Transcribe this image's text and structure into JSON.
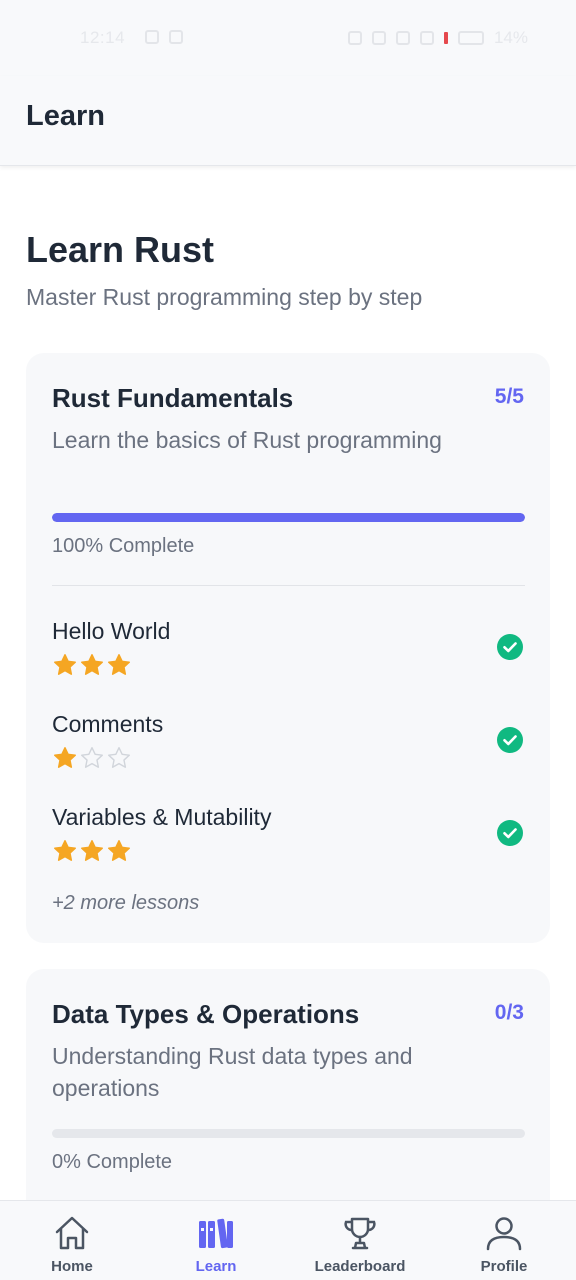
{
  "status_bar": {
    "time": "12:14",
    "battery": "14%"
  },
  "header": {
    "title": "Learn"
  },
  "page": {
    "title": "Learn Rust",
    "subtitle": "Master Rust programming step by step"
  },
  "modules": [
    {
      "title": "Rust Fundamentals",
      "count": "5/5",
      "description": "Learn the basics of Rust programming",
      "progress": 1.0,
      "progress_label": "100% Complete",
      "lessons": [
        {
          "title": "Hello World",
          "stars": 3,
          "icon": "check-circle-icon"
        },
        {
          "title": "Comments",
          "stars": 1,
          "icon": "check-circle-icon"
        },
        {
          "title": "Variables & Mutability",
          "stars": 3,
          "icon": "check-circle-icon"
        }
      ],
      "more_lessons": "+2 more lessons"
    },
    {
      "title": "Data Types & Operations",
      "count": "0/3",
      "description": "Understanding Rust data types and operations",
      "progress": 0.0,
      "progress_label": "0% Complete"
    }
  ],
  "nav": {
    "items": [
      {
        "label": "Home",
        "icon": "home-icon"
      },
      {
        "label": "Learn",
        "icon": "library-icon",
        "active": true
      },
      {
        "label": "Leaderboard",
        "icon": "trophy-icon"
      },
      {
        "label": "Profile",
        "icon": "user-icon"
      }
    ]
  },
  "colors": {
    "accent": "#6366f1",
    "star": "#f5a623",
    "success": "#10b981"
  }
}
